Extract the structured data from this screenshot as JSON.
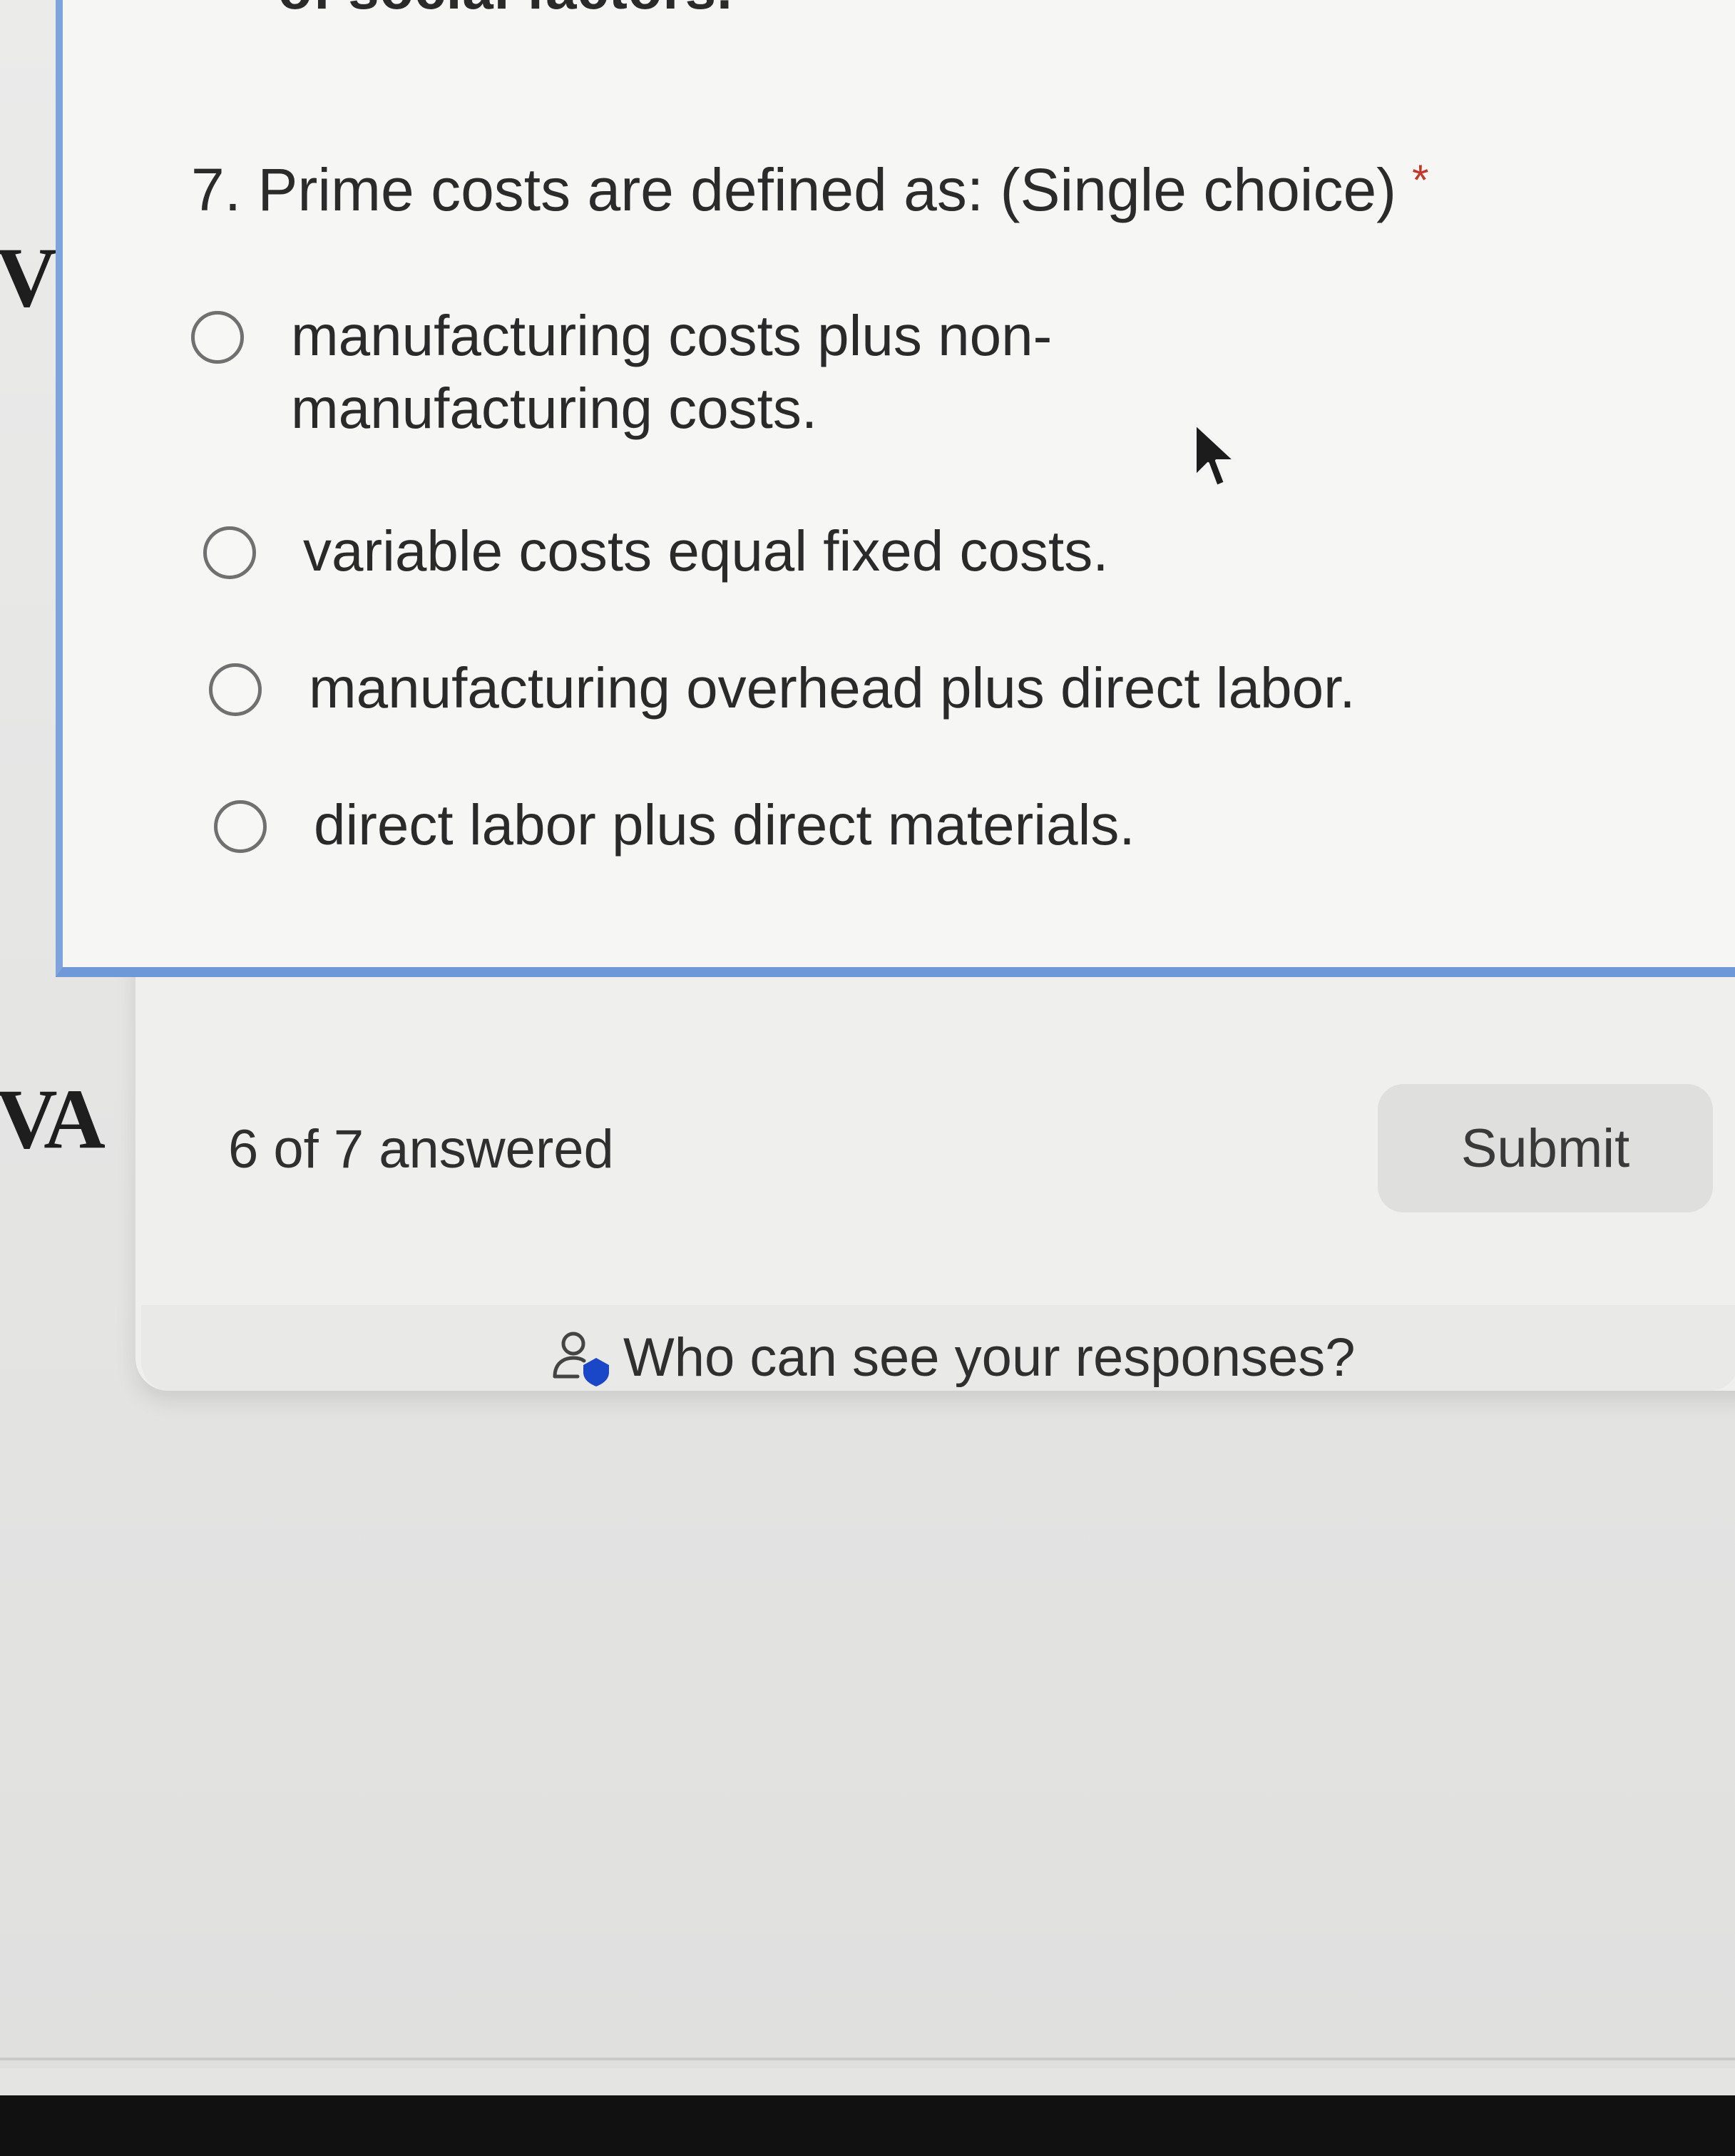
{
  "background": {
    "left_letter_top": "V",
    "left_letter_bottom": "VA"
  },
  "previous_question_tail": "of social factors.",
  "question": {
    "title": "7. Prime costs are defined as: (Single choice)",
    "required_marker": "*",
    "options": [
      {
        "label": "manufacturing costs plus non-manufacturing costs.",
        "selected": false
      },
      {
        "label": "variable costs equal fixed costs.",
        "selected": false
      },
      {
        "label": "manufacturing overhead plus direct labor.",
        "selected": false
      },
      {
        "label": "direct labor plus direct materials.",
        "selected": false
      }
    ]
  },
  "footer": {
    "progress": "6 of 7 answered",
    "submit_label": "Submit",
    "privacy_link": "Who can see your responses?",
    "privacy_icon": "person-shield-icon"
  },
  "colors": {
    "accent_blue": "#6f98d8",
    "required_red": "#c0392b",
    "icon_blue": "#1a47c8"
  }
}
